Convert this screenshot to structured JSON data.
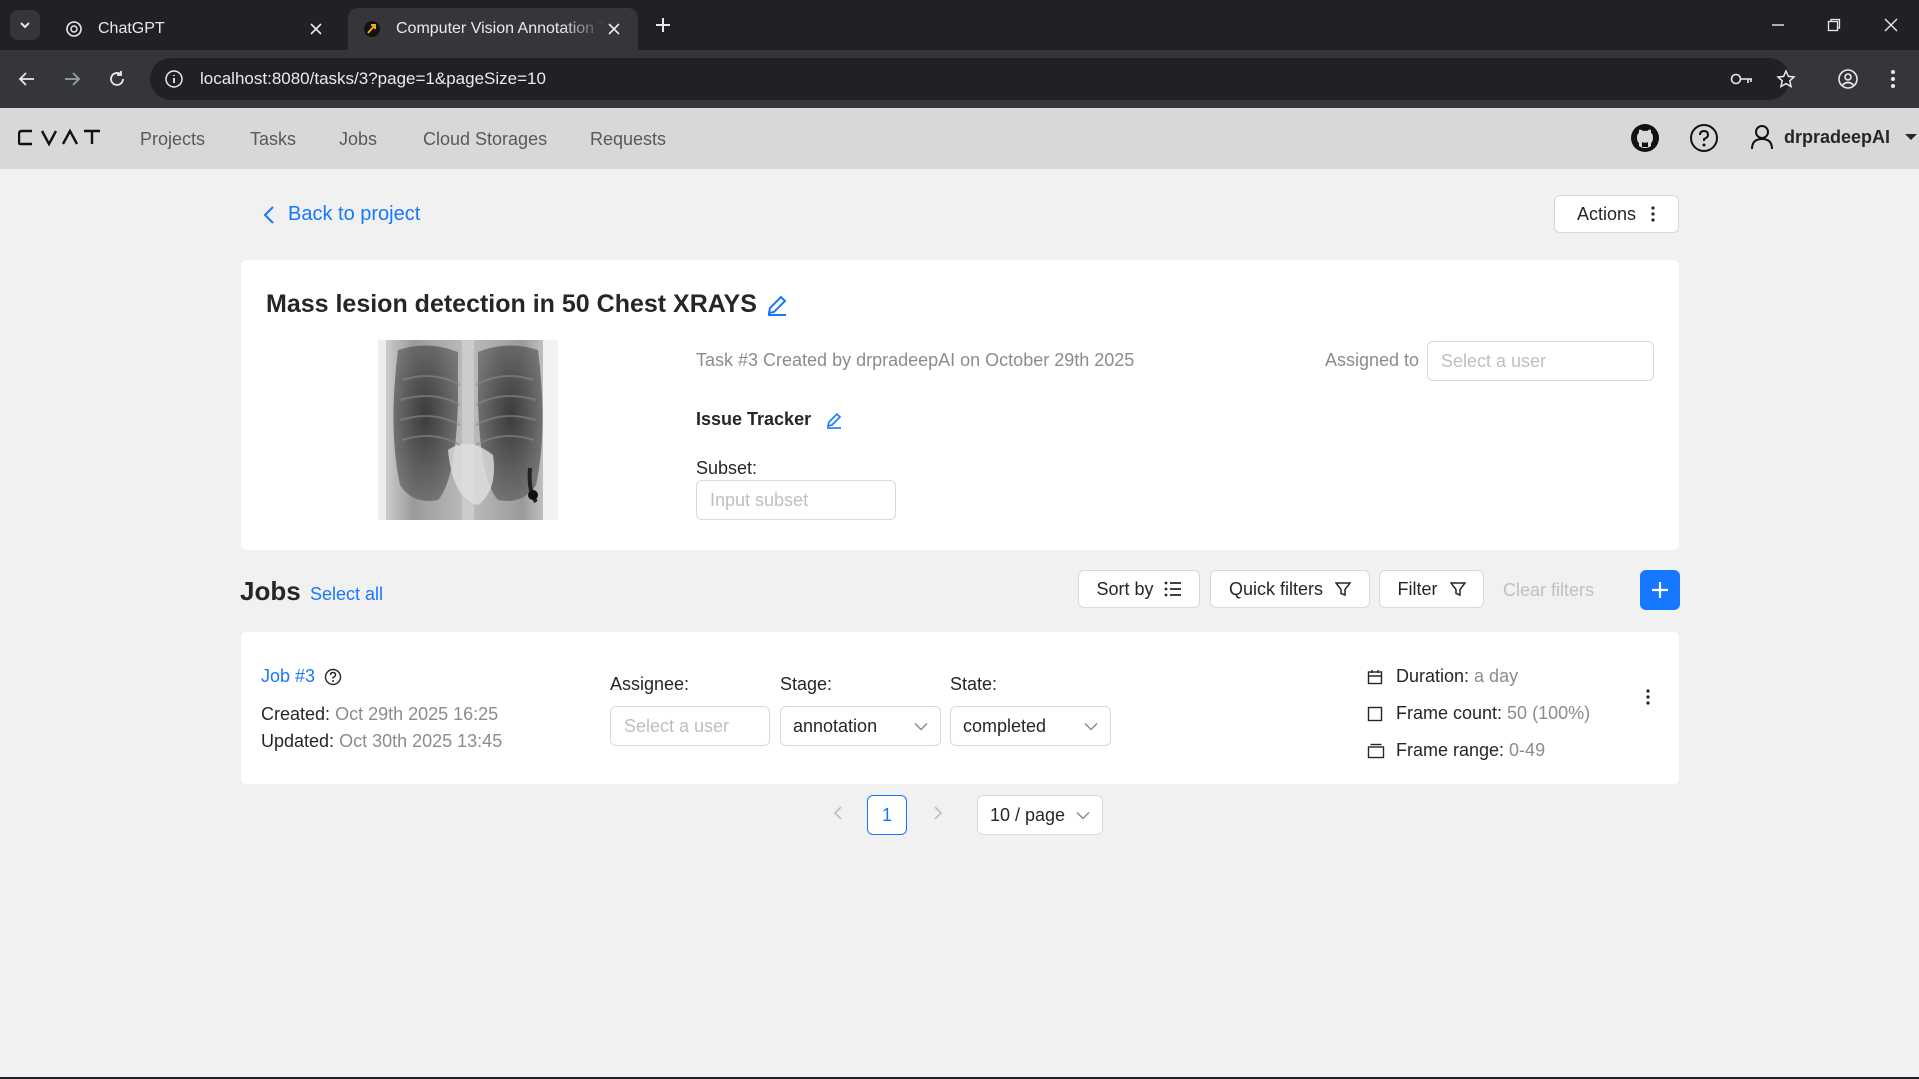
{
  "browser": {
    "tabs": [
      {
        "title": "ChatGPT",
        "active": false
      },
      {
        "title": "Computer Vision Annotation Tool",
        "active": true
      }
    ],
    "url": "localhost:8080/tasks/3?page=1&pageSize=10"
  },
  "header": {
    "logo": "CVAT",
    "menu": [
      "Projects",
      "Tasks",
      "Jobs",
      "Cloud Storages",
      "Requests"
    ],
    "username": "drpradeepAI"
  },
  "page": {
    "back_label": "Back to project",
    "actions_label": "Actions"
  },
  "task": {
    "title": "Mass lesion detection in 50 Chest XRAYS",
    "meta": "Task #3 Created by drpradeepAI on October 29th 2025",
    "assigned_label": "Assigned to",
    "assigned_placeholder": "Select a user",
    "issue_tracker_label": "Issue Tracker",
    "subset_label": "Subset:",
    "subset_placeholder": "Input subset"
  },
  "jobs": {
    "title": "Jobs",
    "select_all": "Select all",
    "sort_label": "Sort by",
    "quick_filters_label": "Quick filters",
    "filter_label": "Filter",
    "clear_filters_label": "Clear filters",
    "items": [
      {
        "name": "Job #3",
        "created_label": "Created:",
        "created": "Oct 29th 2025 16:25",
        "updated_label": "Updated:",
        "updated": "Oct 30th 2025 13:45",
        "assignee_label": "Assignee:",
        "assignee_placeholder": "Select a user",
        "stage_label": "Stage:",
        "stage": "annotation",
        "state_label": "State:",
        "state": "completed",
        "duration_label": "Duration:",
        "duration": "a day",
        "frame_count_label": "Frame count:",
        "frame_count": "50 (100%)",
        "frame_range_label": "Frame range:",
        "frame_range": "0-49"
      }
    ]
  },
  "pagination": {
    "current": "1",
    "page_size": "10 / page"
  },
  "colors": {
    "accent": "#1677ff",
    "header_bg": "#d8d8d8",
    "page_bg": "#f1f1f1"
  }
}
